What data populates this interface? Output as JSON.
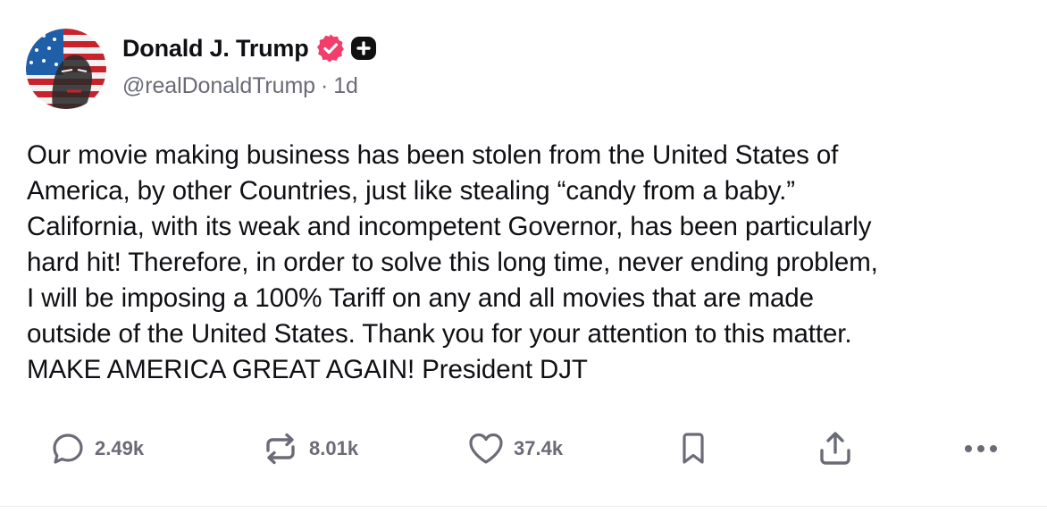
{
  "post": {
    "author": {
      "name": "Donald J. Trump",
      "handle": "@realDonaldTrump",
      "separator": "·",
      "time": "1d",
      "avatar_icon": "avatar-portrait-flag",
      "verified_icon": "verified-badge-icon",
      "verified_color": "#f23e6b",
      "plus_icon": "plus-badge-icon"
    },
    "text": [
      "Our movie making business has been stolen from the United States of",
      "America, by other Countries, just like stealing “candy from a baby.”",
      "California, with its weak and incompetent Governor, has been particularly",
      "hard hit! Therefore, in order to solve this long time, never ending problem,",
      "I will be imposing a 100% Tariff on any and all movies that are made",
      "outside of the United States. Thank you for your attention to this matter.",
      "MAKE AMERICA GREAT AGAIN! President DJT"
    ],
    "actions": {
      "reply": {
        "icon": "reply-icon",
        "count": "2.49k"
      },
      "repost": {
        "icon": "repost-icon",
        "count": "8.01k"
      },
      "like": {
        "icon": "heart-icon",
        "count": "37.4k"
      },
      "bookmark": {
        "icon": "bookmark-icon"
      },
      "share": {
        "icon": "share-icon"
      },
      "more": {
        "icon": "more-icon"
      }
    },
    "colors": {
      "text": "#0f0f14",
      "muted": "#6b6b78",
      "icon": "#6b6b78"
    }
  }
}
